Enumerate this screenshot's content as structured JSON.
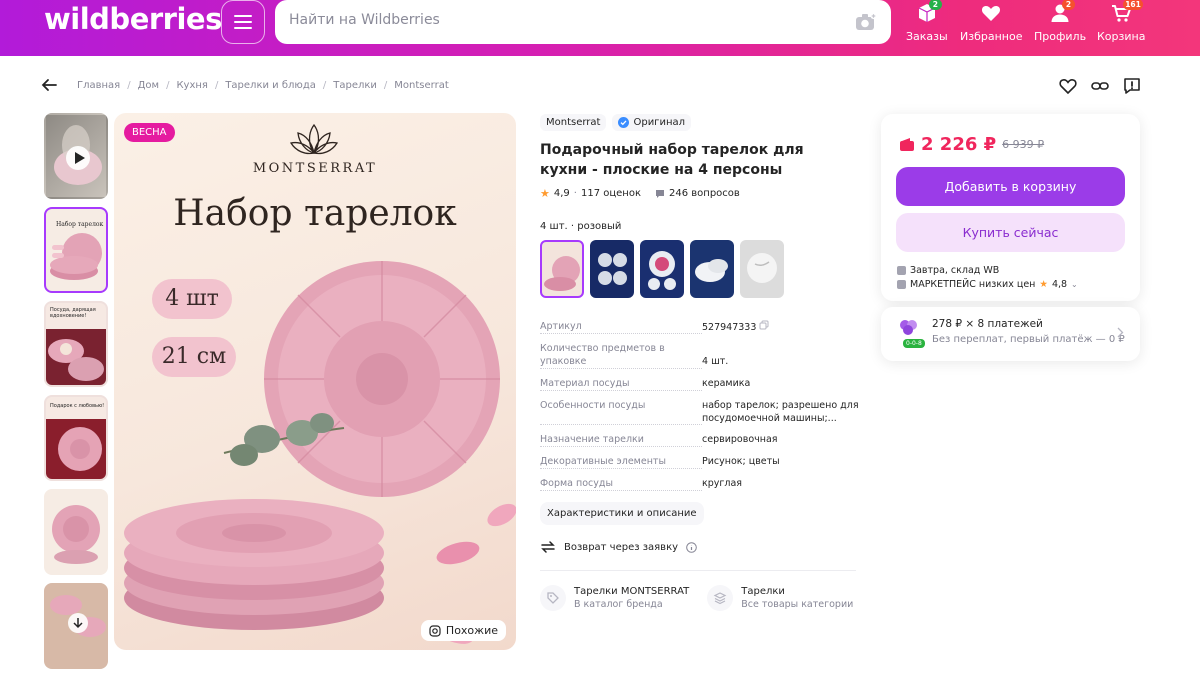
{
  "header": {
    "logo": "wildberries",
    "search_placeholder": "Найти на Wildberries",
    "nav": [
      {
        "label": "Заказы",
        "icon": "box-icon",
        "badge": "2"
      },
      {
        "label": "Избранное",
        "icon": "heart-icon",
        "badge": ""
      },
      {
        "label": "Профиль",
        "icon": "user-icon",
        "badge": "2"
      },
      {
        "label": "Корзина",
        "icon": "cart-icon",
        "badge": "161"
      }
    ],
    "colors": {
      "gradient_start": "#b21bd9",
      "gradient_end": "#f3367b"
    }
  },
  "breadcrumbs": [
    "Главная",
    "Дом",
    "Кухня",
    "Тарелки и блюда",
    "Тарелки",
    "Montserrat"
  ],
  "gallery": {
    "badge": "ВЕСНА",
    "image_text": {
      "brand": "MONTSERRAT",
      "headline": "Набор тарелок",
      "pill_1": "4 шт",
      "pill_2": "21 см"
    },
    "thumb_texts": {
      "t2": "Набор тарелок",
      "t3": "Посуда, дарящая вдохновение!",
      "t4": "Подарок с любовью!"
    },
    "similar_label": "Похожие"
  },
  "product": {
    "brand": "Montserrat",
    "original_label": "Оригинал",
    "title": "Подарочный набор тарелок для кухни - плоские на 4 персоны",
    "rating": "4,9",
    "reviews": "117 оценок",
    "questions": "246 вопросов",
    "variant": "4 шт. · розовый",
    "specs": [
      {
        "key": "Артикул",
        "value": "527947333"
      },
      {
        "key": "Количество предметов в упаковке",
        "value": "4 шт."
      },
      {
        "key": "Материал посуды",
        "value": "керамика"
      },
      {
        "key": "Особенности посуды",
        "value": "набор тарелок; разрешено для посудомоечной машины;..."
      },
      {
        "key": "Назначение тарелки",
        "value": "сервировочная"
      },
      {
        "key": "Декоративные элементы",
        "value": "Рисунок; цветы"
      },
      {
        "key": "Форма посуды",
        "value": "круглая"
      }
    ],
    "characteristics_button": "Характеристики и описание",
    "return_label": "Возврат через заявку",
    "brand_catalog": {
      "title": "Тарелки MONTSERRAT",
      "subtitle": "В каталог бренда"
    },
    "category_catalog": {
      "title": "Тарелки",
      "subtitle": "Все товары категории"
    }
  },
  "buybox": {
    "price": "2 226 ₽",
    "old_price": "6 939 ₽",
    "add_to_cart": "Добавить в корзину",
    "buy_now": "Купить сейчас",
    "delivery": "Завтра, склад WB",
    "seller": "МАРКЕТПЕЙС низких цен",
    "seller_rating": "4,8",
    "accent_color": "#f0265d",
    "button_color": "#9b3ce8"
  },
  "installments": {
    "title": "278 ₽ × 8 платежей",
    "subtitle": "Без переплат, первый платёж — 0 ₽",
    "badge": "0-0-8"
  }
}
